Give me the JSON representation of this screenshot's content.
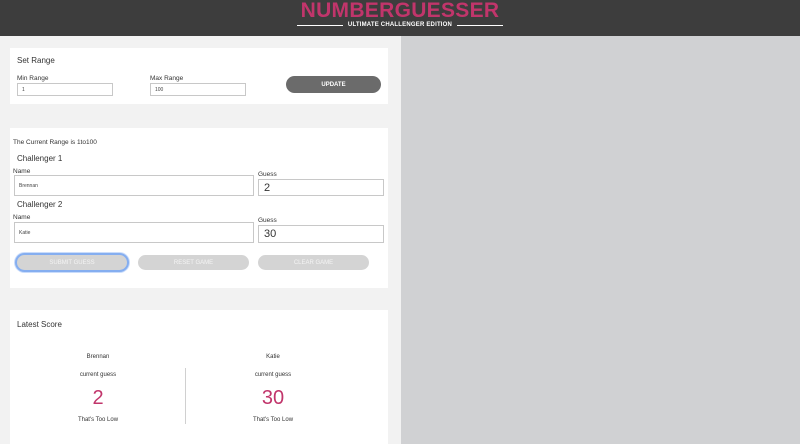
{
  "header": {
    "title": "NUMBERGUESSER",
    "subtitle": "ULTIMATE CHALLENGER EDITION"
  },
  "range": {
    "heading": "Set Range",
    "min_label": "Min Range",
    "min_value": "1",
    "max_label": "Max Range",
    "max_value": "100",
    "update_label": "UPDATE"
  },
  "game": {
    "range_text": "The Current Range is 1to100",
    "challenger1": {
      "heading": "Challenger 1",
      "name_label": "Name",
      "name_value": "Brennan",
      "guess_label": "Guess",
      "guess_value": "2"
    },
    "challenger2": {
      "heading": "Challenger 2",
      "name_label": "Name",
      "name_value": "Katie",
      "guess_label": "Guess",
      "guess_value": "30"
    },
    "submit_label": "SUBMIT GUESS",
    "reset_label": "RESET GAME",
    "clear_label": "CLEAR GAME"
  },
  "score": {
    "heading": "Latest Score",
    "players": [
      {
        "name": "Brennan",
        "caption": "current guess",
        "guess": "2",
        "feedback": "That's Too Low"
      },
      {
        "name": "Katie",
        "caption": "current guess",
        "guess": "30",
        "feedback": "That's Too Low"
      }
    ]
  },
  "colors": {
    "accent": "#c1356b",
    "header_bg": "#3d3d3d",
    "panel_bg": "#d0d1d3"
  }
}
